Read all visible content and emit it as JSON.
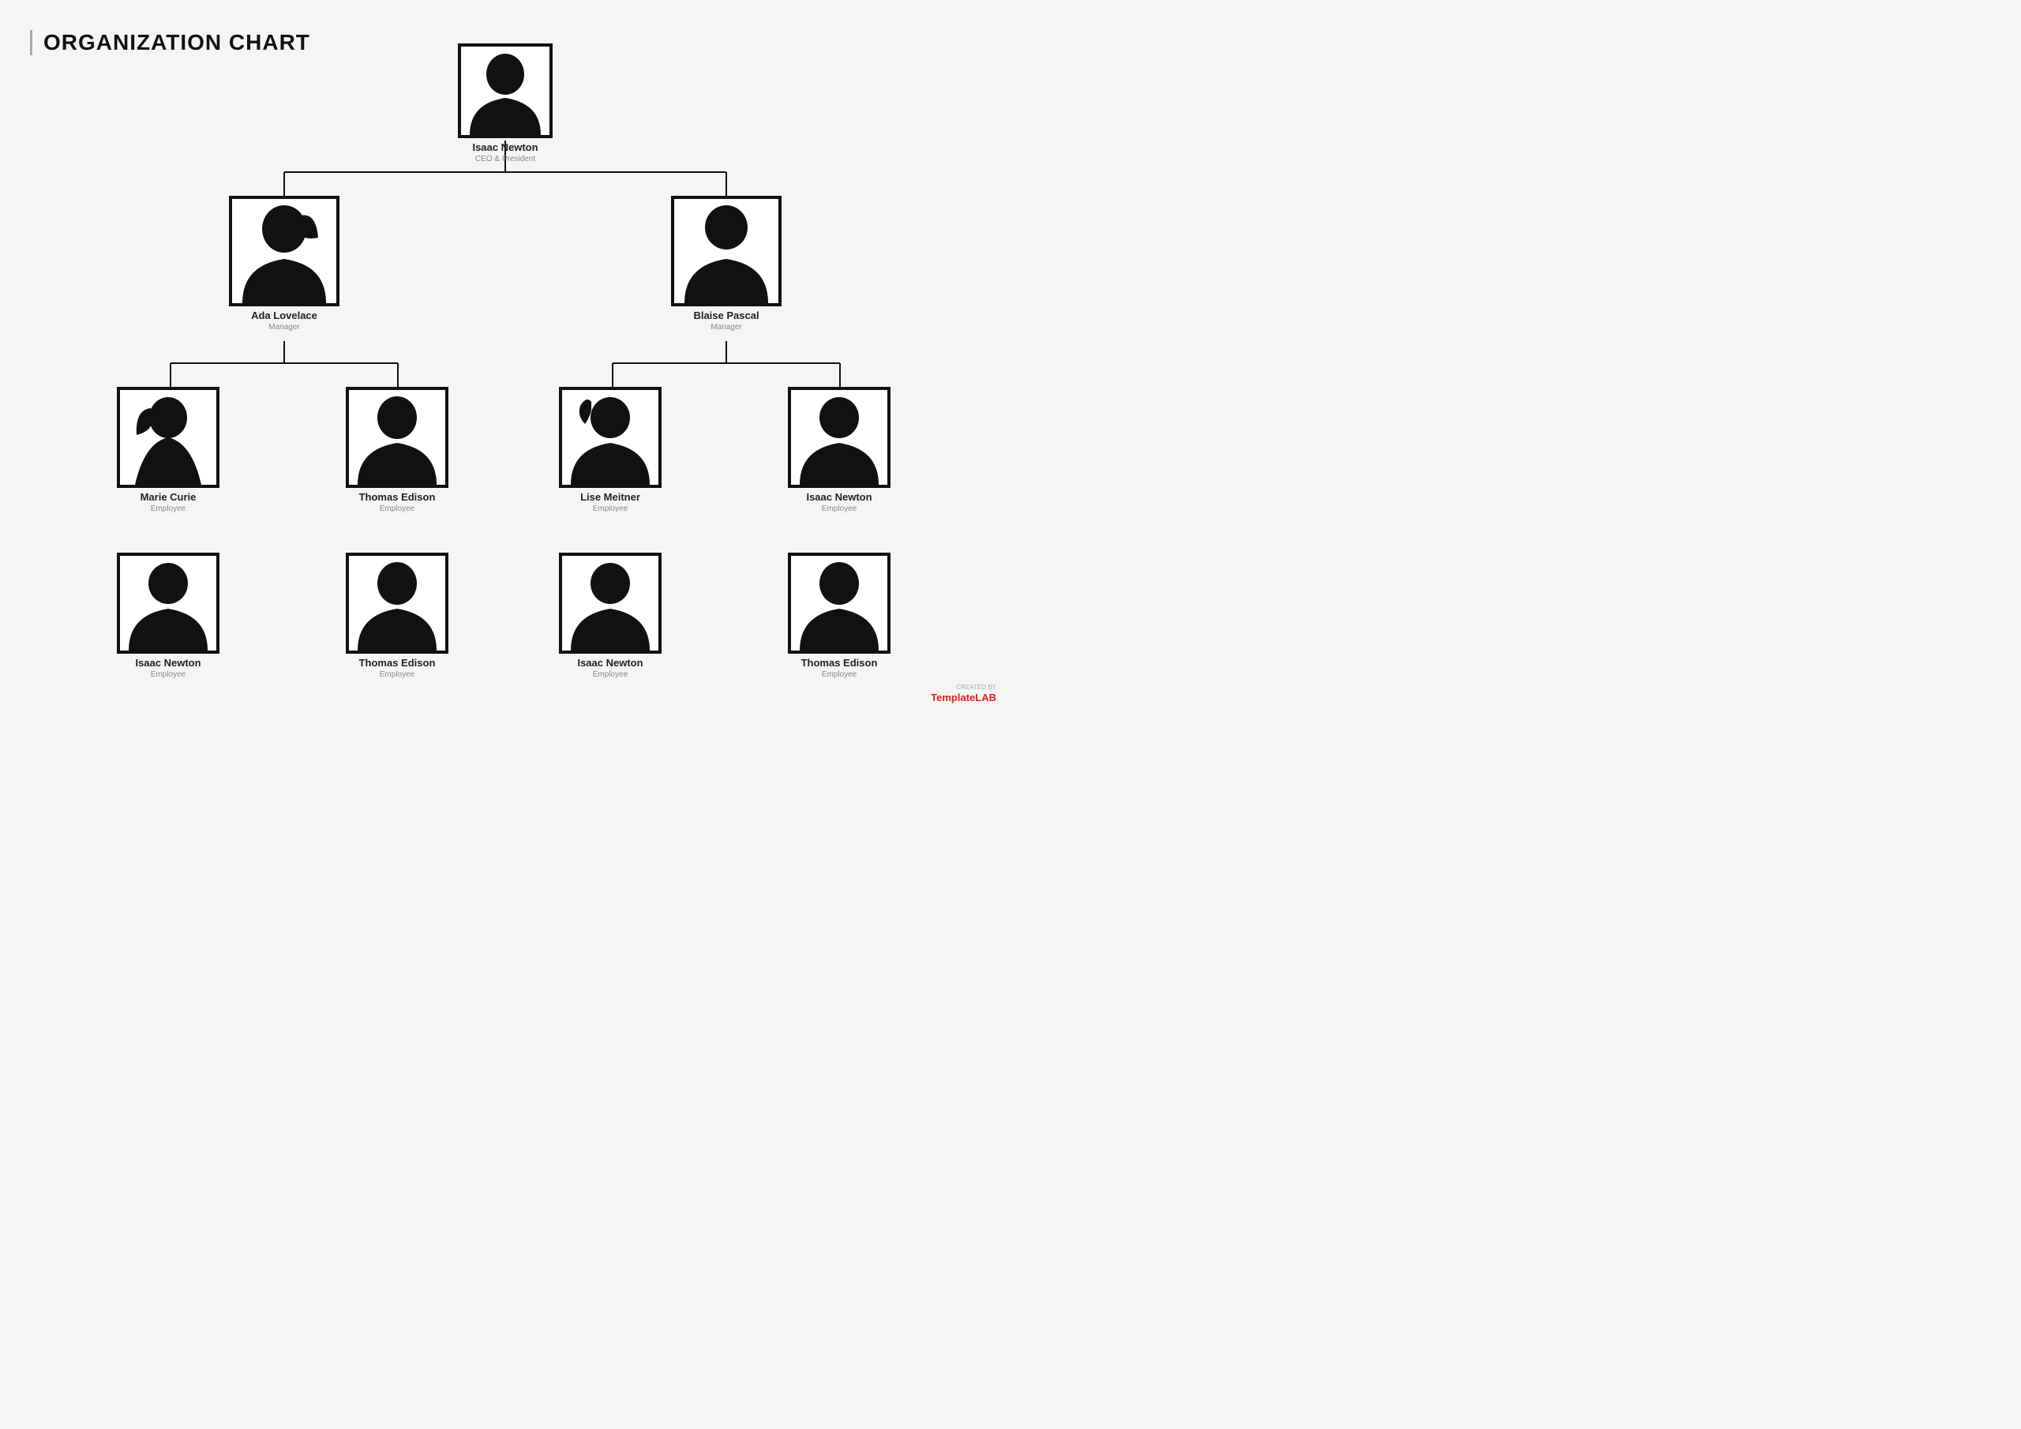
{
  "page": {
    "title": "ORGANIZATION CHART",
    "background": "#f5f5f3"
  },
  "brand": {
    "created_by": "CREATED BY",
    "name_part1": "Template",
    "name_part2": "LAB"
  },
  "nodes": {
    "ceo": {
      "name": "Isaac Newton",
      "title": "CEO & President",
      "photo_size": "large"
    },
    "manager_left": {
      "name": "Ada Lovelace",
      "title": "Manager",
      "photo_size": "medium",
      "gender": "female"
    },
    "manager_right": {
      "name": "Blaise Pascal",
      "title": "Manager",
      "photo_size": "medium",
      "gender": "male"
    },
    "employees": [
      {
        "name": "Marie Curie",
        "title": "Employee",
        "gender": "female2"
      },
      {
        "name": "Thomas Edison",
        "title": "Employee",
        "gender": "male2"
      },
      {
        "name": "Lise Meitner",
        "title": "Employee",
        "gender": "female3"
      },
      {
        "name": "Isaac Newton",
        "title": "Employee",
        "gender": "male3"
      },
      {
        "name": "Isaac Newton",
        "title": "Employee",
        "gender": "male4"
      },
      {
        "name": "Thomas Edison",
        "title": "Employee",
        "gender": "male5"
      },
      {
        "name": "Isaac Newton",
        "title": "Employee",
        "gender": "male6"
      },
      {
        "name": "Thomas Edison",
        "title": "Employee",
        "gender": "male7"
      }
    ]
  }
}
